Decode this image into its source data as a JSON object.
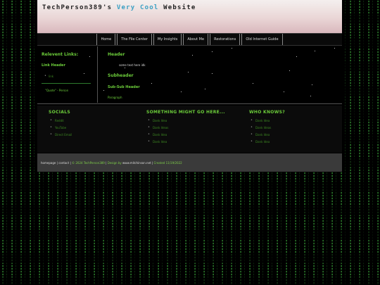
{
  "site": {
    "title_part1": "TechPerson389's ",
    "title_accent": "Very Cool",
    "title_part2": " Website"
  },
  "nav": {
    "items": [
      "Home",
      "The File Center",
      "My Insights",
      "About Me",
      "Restorations",
      "Old Internet Guide"
    ]
  },
  "sidebar": {
    "title": "Relevent Links:",
    "header": "Link Header",
    "link": "link",
    "quote": "\"Quote\" - Person"
  },
  "main": {
    "header": "Header",
    "text": "some text here idk",
    "subheader": "Subheader",
    "subsubheader": "Sub-Sub Header",
    "paragraph": "Paragraph"
  },
  "footer_cols": [
    {
      "title": "SOCIALS",
      "items": [
        "Reddit",
        "YouTube",
        "Direct Email"
      ]
    },
    {
      "title": "SOMETHING MIGHT GO HERE...",
      "items": [
        "Dank Idea",
        "Dank Ideas",
        "Dank Idea",
        "Dank Idea"
      ]
    },
    {
      "title": "WHO KNOWS?",
      "items": [
        "Dank Idea",
        "Dank Ideas",
        "Dank Idea",
        "Dank Idea"
      ]
    }
  ],
  "bottom": {
    "homepage": "homepage",
    "contact": "contact",
    "copyright": "© 2024 TechPerson389",
    "design_prefix": "Design by",
    "design_site": "www.mitchinson.net",
    "created": "Created 11/19/2022"
  },
  "colors": {
    "accent_green": "#6ccd3a",
    "link_green": "#3d8a22",
    "title_accent": "#3aa0c4"
  }
}
